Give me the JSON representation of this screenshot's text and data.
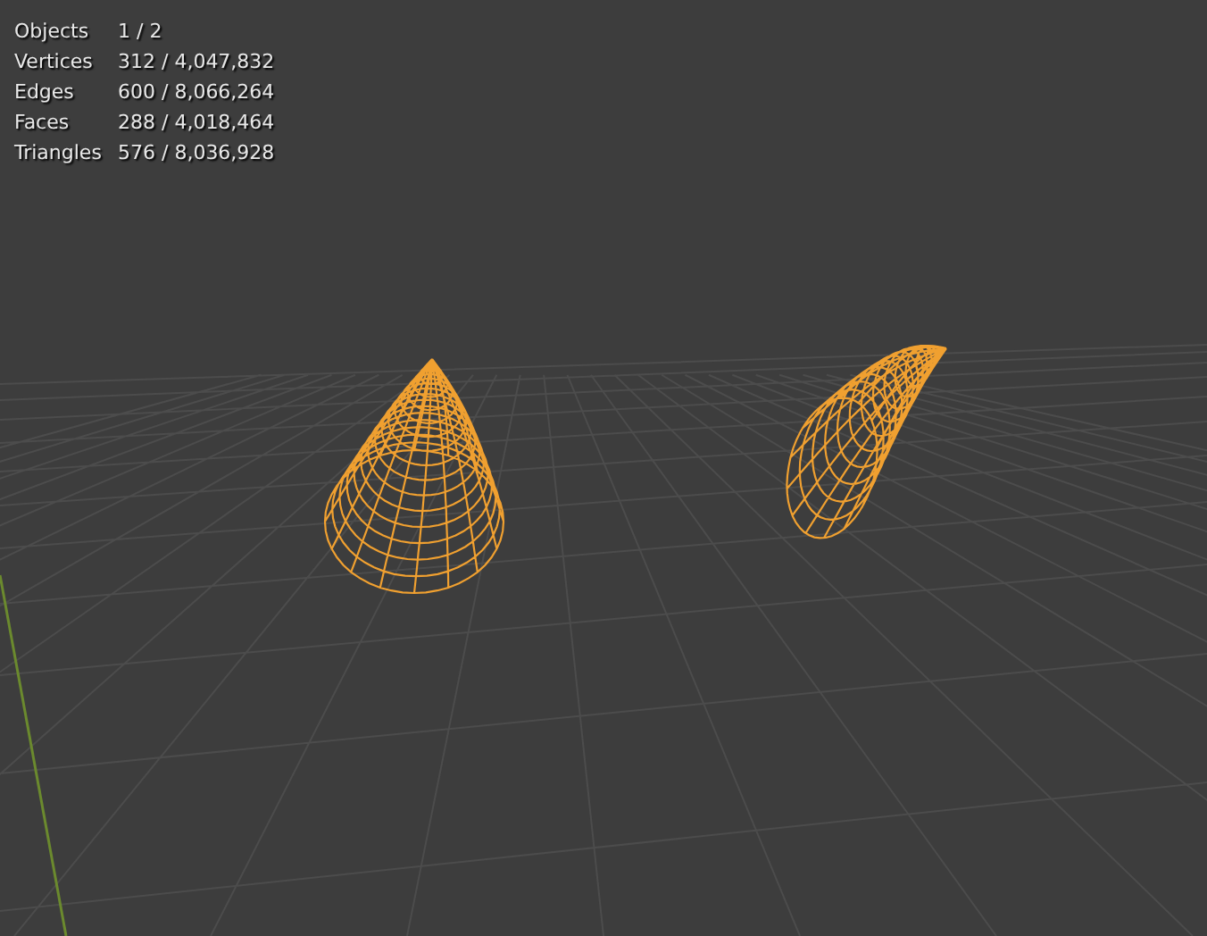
{
  "statistics": [
    {
      "label": "Objects",
      "value": "1 / 2"
    },
    {
      "label": "Vertices",
      "value": "312 / 4,047,832"
    },
    {
      "label": "Edges",
      "value": "600 / 8,066,264"
    },
    {
      "label": "Faces",
      "value": "288 / 4,018,464"
    },
    {
      "label": "Triangles",
      "value": "576 / 8,036,928"
    }
  ]
}
